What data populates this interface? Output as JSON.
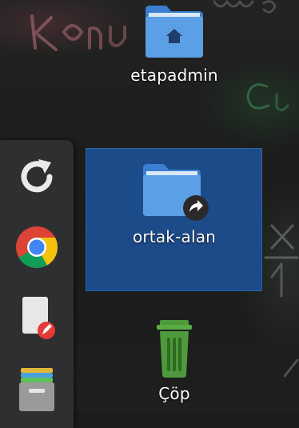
{
  "desktop": {
    "icons": [
      {
        "label": "etapadmin",
        "icon": "home-folder-icon",
        "selected": false
      },
      {
        "label": "ortak-alan",
        "icon": "shared-folder-icon",
        "selected": true
      },
      {
        "label": "Çöp",
        "icon": "trash-icon",
        "selected": false
      }
    ]
  },
  "dock": {
    "items": [
      {
        "name": "refresh",
        "icon": "refresh-icon"
      },
      {
        "name": "chrome",
        "icon": "chrome-icon"
      },
      {
        "name": "document-editor",
        "icon": "document-edit-icon"
      },
      {
        "name": "file-manager",
        "icon": "file-cabinet-icon"
      }
    ]
  },
  "colors": {
    "folder": "#4a90d9",
    "selection": "#1d4b8a",
    "trash": "#4f9a3c",
    "dock": "#2e2f31"
  }
}
